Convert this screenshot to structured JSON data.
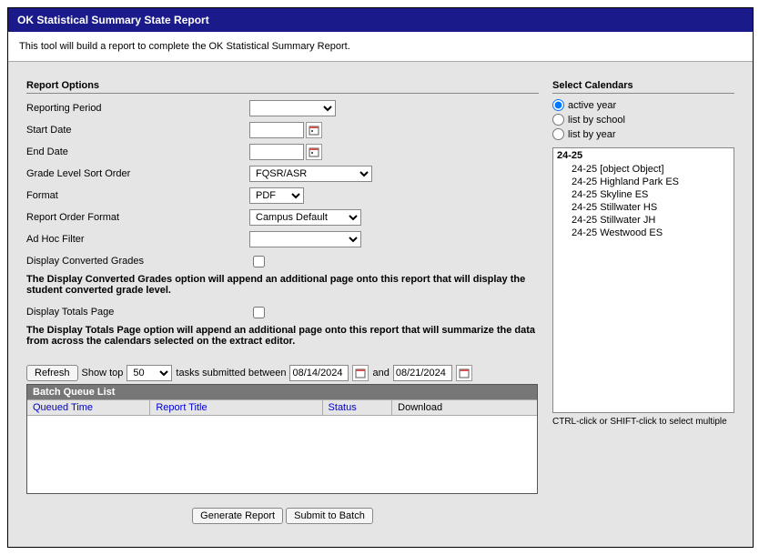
{
  "titleBar": "OK Statistical Summary State Report",
  "intro": "This tool will build a report to complete the OK Statistical Summary Report.",
  "reportOptions": {
    "sectionTitle": "Report Options",
    "reportingPeriodLabel": "Reporting Period",
    "startDateLabel": "Start Date",
    "endDateLabel": "End Date",
    "gradeLevelSortLabel": "Grade Level Sort Order",
    "gradeLevelSortValue": "FQSR/ASR",
    "formatLabel": "Format",
    "formatValue": "PDF",
    "reportOrderFormatLabel": "Report Order Format",
    "reportOrderFormatValue": "Campus Default",
    "adHocFilterLabel": "Ad Hoc Filter",
    "displayConvertedGradesLabel": "Display Converted Grades",
    "displayConvertedGradesNote": "The Display Converted Grades option will append an additional page onto this report that will display the student converted grade level.",
    "displayTotalsPageLabel": "Display Totals Page",
    "displayTotalsPageNote": "The Display Totals Page option will append an additional page onto this report that will summarize the data from across the calendars selected on the extract editor."
  },
  "batchQueue": {
    "refreshLabel": "Refresh",
    "showTopLabel": "Show top",
    "showTopValue": "50",
    "tasksBetweenLabel": "tasks submitted between",
    "date1": "08/14/2024",
    "andLabel": "and",
    "date2": "08/21/2024",
    "listTitle": "Batch Queue List",
    "colQueuedTime": "Queued Time",
    "colReportTitle": "Report Title",
    "colStatus": "Status",
    "colDownload": "Download"
  },
  "buttons": {
    "generateReport": "Generate Report",
    "submitToBatch": "Submit to Batch"
  },
  "calendars": {
    "sectionTitle": "Select Calendars",
    "optActiveYear": "active year",
    "optListBySchool": "list by school",
    "optListByYear": "list by year",
    "yearLabel": "24-25",
    "items": [
      "24-25 [object Object]",
      "24-25 Highland Park ES",
      "24-25 Skyline ES",
      "24-25 Stillwater HS",
      "24-25 Stillwater JH",
      "24-25 Westwood ES"
    ],
    "hint": "CTRL-click or SHIFT-click to select multiple"
  }
}
